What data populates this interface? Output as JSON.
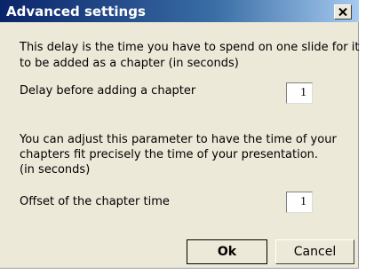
{
  "window": {
    "title": "Advanced settings",
    "close_icon": "close-icon"
  },
  "chapter_delay": {
    "description_line1": "This delay is the time you have to spend on one slide for it",
    "description_line2": "to be added as a chapter (in seconds)",
    "label": "Delay before adding a chapter",
    "value": "1"
  },
  "chapter_offset": {
    "description_line1": "You can adjust this parameter to have the time of your",
    "description_line2": "chapters fit precisely the time of your presentation.",
    "description_line3": "(in seconds)",
    "label": "Offset of the chapter time",
    "value": "1"
  },
  "buttons": {
    "ok_label": "Ok",
    "cancel_label": "Cancel"
  },
  "colors": {
    "titlebar_start": "#0a246a",
    "titlebar_end": "#a6caf0",
    "dialog_background": "#ece9d8"
  }
}
